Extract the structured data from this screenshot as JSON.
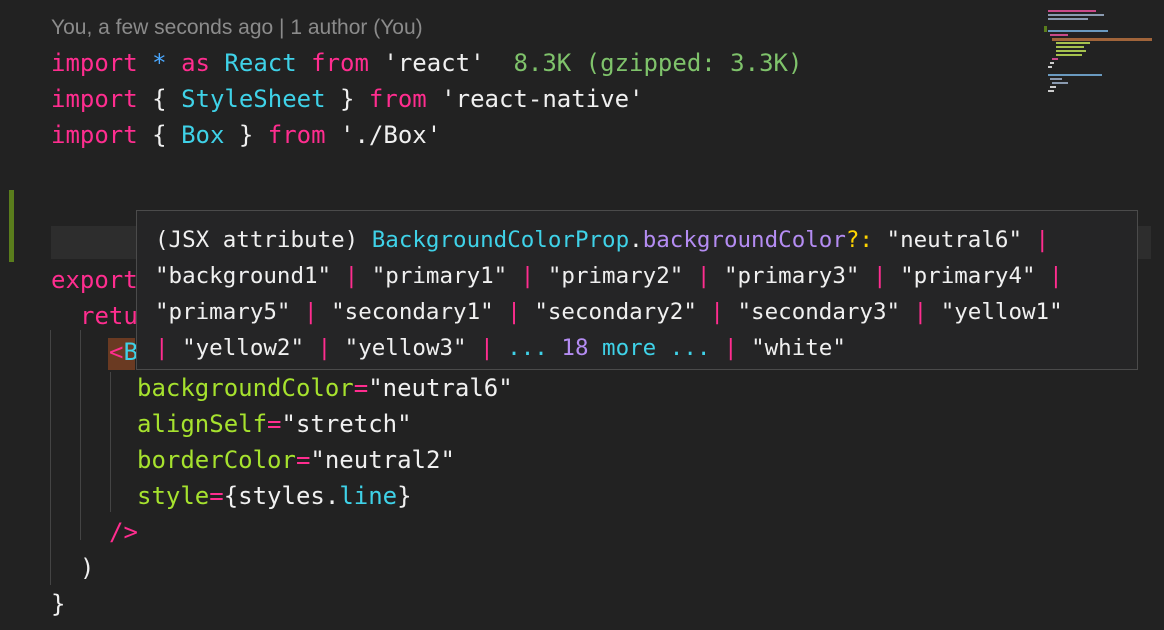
{
  "blame": "You, a few seconds ago | 1 author (You)",
  "code": {
    "import1": {
      "kw_import": "import",
      "star": "*",
      "kw_as": "as",
      "name": "React",
      "kw_from": "from",
      "module": "'react'",
      "size": "8.3K (gzipped: 3.3K)"
    },
    "import2": {
      "kw_import": "import",
      "open": "{",
      "name": "StyleSheet",
      "close": "}",
      "kw_from": "from",
      "module": "'react-native'"
    },
    "import3": {
      "kw_import": "import",
      "open": "{",
      "name": "Box",
      "close": "}",
      "kw_from": "from",
      "module": "'./Box'"
    },
    "export_partial": "export",
    "return_partial": "retu",
    "tag_partial_bracket": "<",
    "tag_partial_name": "B",
    "attr1": {
      "name": "backgroundColor",
      "eq": "=",
      "value": "\"neutral6\""
    },
    "attr2": {
      "name": "alignSelf",
      "eq": "=",
      "value": "\"stretch\""
    },
    "attr3": {
      "name": "borderColor",
      "eq": "=",
      "value": "\"neutral2\""
    },
    "attr4": {
      "name": "style",
      "eq": "=",
      "open": "{",
      "obj": "styles",
      "dot": ".",
      "prop": "line",
      "close": "}"
    },
    "self_close": "/>",
    "close_paren": ")",
    "close_brace": "}"
  },
  "hover": {
    "prefix": "(JSX attribute) ",
    "type_name": "BackgroundColorProp",
    "dot": ".",
    "prop_name": "backgroundColor",
    "optional": "?:",
    "pipe": "|",
    "values": {
      "v1": "\"neutral6\"",
      "v2": "\"background1\"",
      "v3": "\"primary1\"",
      "v4": "\"primary2\"",
      "v5": "\"primary3\"",
      "v6": "\"primary4\"",
      "v7": "\"primary5\"",
      "v8": "\"secondary1\"",
      "v9": "\"secondary2\"",
      "v10": "\"secondary3\"",
      "v11": "\"yellow1\"",
      "v12": "\"yellow2\"",
      "v13": "\"yellow3\"",
      "v_last": "\"white\""
    },
    "ellipsis": "...",
    "more_count": "18",
    "more_label": "more"
  },
  "colors": {
    "background": "#222222",
    "keyword": "#ff2d8f",
    "identifier": "#3fd2e8",
    "attribute": "#a6e22e",
    "string": "#f0f0f0",
    "size_hint": "#7fc36b",
    "property": "#b48cf2",
    "optional_marker": "#ffd500",
    "gutter_modified": "#5a7d1c"
  }
}
